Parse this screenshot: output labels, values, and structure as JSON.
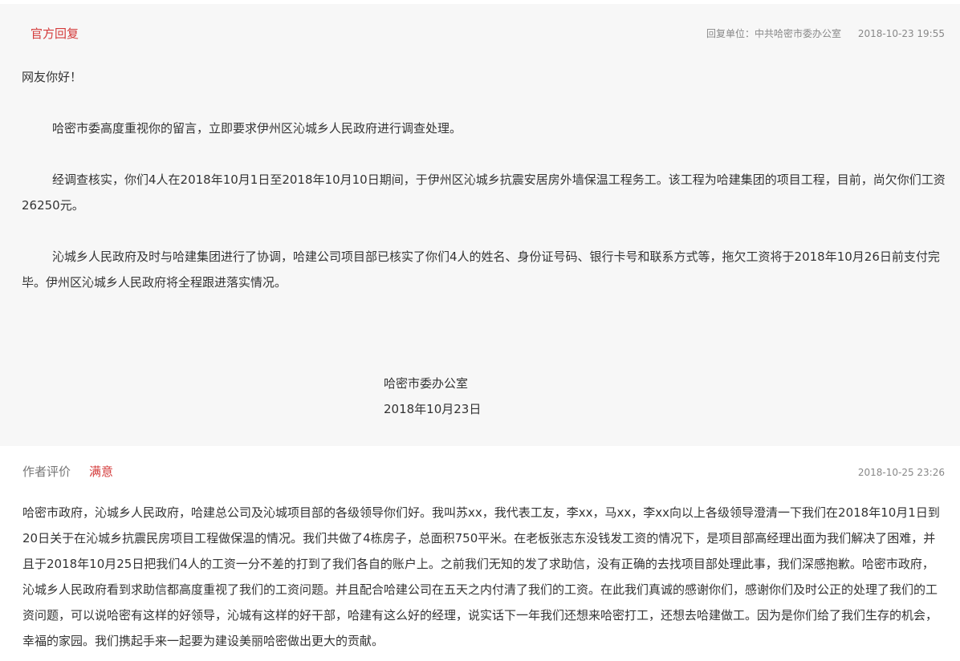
{
  "official_reply": {
    "tag": "官方回复",
    "unit": "回复单位：中共哈密市委办公室",
    "time": "2018-10-23 19:55",
    "greeting": "网友你好！",
    "paragraphs": [
      "哈密市委高度重视你的留言，立即要求伊州区沁城乡人民政府进行调查处理。",
      "经调查核实，你们4人在2018年10月1日至2018年10月10日期间，于伊州区沁城乡抗震安居房外墙保温工程务工。该工程为哈建集团的项目工程，目前，尚欠你们工资26250元。",
      "沁城乡人民政府及时与哈建集团进行了协调，哈建公司项目部已核实了你们4人的姓名、身份证号码、银行卡号和联系方式等，拖欠工资将于2018年10月26日前支付完毕。伊州区沁城乡人民政府将全程跟进落实情况。"
    ],
    "signature_org": "哈密市委办公室",
    "signature_date": "2018年10月23日"
  },
  "author_evaluation": {
    "label": "作者评价",
    "result": "满意",
    "time": "2018-10-25 23:26",
    "text": "哈密市政府，沁城乡人民政府，哈建总公司及沁城项目部的各级领导你们好。我叫苏xx，我代表工友，李xx，马xx，李xx向以上各级领导澄清一下我们在2018年10月1日到20日关于在沁城乡抗震民房项目工程做保温的情况。我们共做了4栋房子，总面积750平米。在老板张志东没钱发工资的情况下，是项目部高经理出面为我们解决了困难，并且于2018年10月25日把我们4人的工资一分不差的打到了我们各自的账户上。之前我们无知的发了求助信，没有正确的去找项目部处理此事，我们深感抱歉。哈密市政府，沁城乡人民政府看到求助信都高度重视了我们的工资问题。并且配合哈建公司在五天之内付清了我们的工资。在此我们真诚的感谢你们，感谢你们及时公正的处理了我们的工资问题，可以说哈密有这样的好领导，沁城有这样的好干部，哈建有这么好的经理，说实话下一年我们还想来哈密打工，还想去哈建做工。因为是你们给了我们生存的机会，幸福的家园。我们携起手来一起要为建设美丽哈密做出更大的贡献。"
  }
}
